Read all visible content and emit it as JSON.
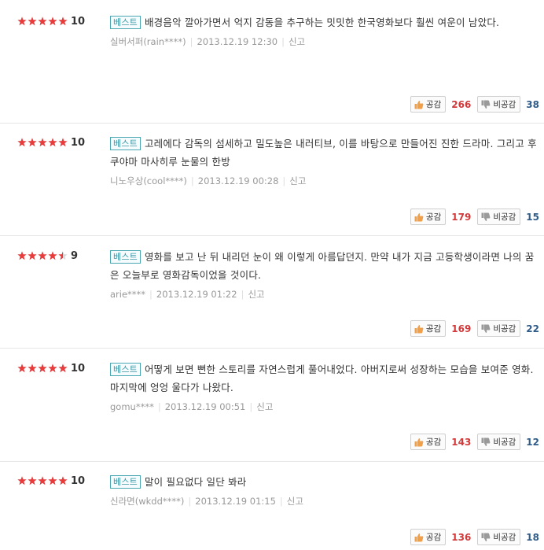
{
  "labels": {
    "best": "베스트",
    "like": "공감",
    "dislike": "비공감",
    "report": "신고"
  },
  "colors": {
    "star_full": "#e83b3b",
    "star_empty": "#d7d7d7",
    "like_count": "#d03a3a",
    "dislike_count": "#2e5b8a",
    "badge_border": "#4aa7b4"
  },
  "reviews": [
    {
      "score": "10",
      "stars": 5,
      "text": "배경음악 깔아가면서 억지 감동을 추구하는 밋밋한 한국영화보다 훨씬 여운이 남았다.",
      "author": "실버서퍼(rain****)",
      "date": "2013.12.19 12:30",
      "likes": "266",
      "dislikes": "38"
    },
    {
      "score": "10",
      "stars": 5,
      "text": "고레에다 감독의 섬세하고 밀도높은 내러티브, 이를 바탕으로 만들어진 진한 드라마. 그리고 후쿠야마 마사히루 눈물의 한방",
      "author": "니노우상(cool****)",
      "date": "2013.12.19 00:28",
      "likes": "179",
      "dislikes": "15"
    },
    {
      "score": "9",
      "stars": 4.5,
      "text": "영화를 보고 난 뒤 내리던 눈이 왜 이렇게 아름답던지. 만약 내가 지금 고등학생이라면 나의 꿈은 오늘부로 영화감독이었을 것이다.",
      "author": "arie****",
      "date": "2013.12.19 01:22",
      "likes": "169",
      "dislikes": "22"
    },
    {
      "score": "10",
      "stars": 5,
      "text": "어떻게 보면 뻔한 스토리를 자연스럽게 풀어내었다. 아버지로써 성장하는 모습을 보여준 영화. 마지막에 엉엉 울다가 나왔다.",
      "author": "gomu****",
      "date": "2013.12.19 00:51",
      "likes": "143",
      "dislikes": "12"
    },
    {
      "score": "10",
      "stars": 5,
      "text": "말이 필요없다 일단 봐라",
      "author": "신라면(wkdd****)",
      "date": "2013.12.19 01:15",
      "likes": "136",
      "dislikes": "18"
    }
  ]
}
